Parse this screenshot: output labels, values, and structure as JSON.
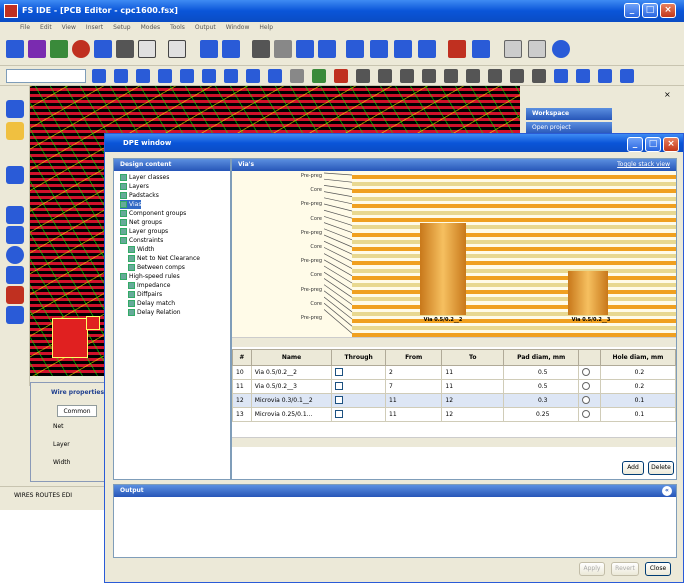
{
  "app": {
    "title": "FS IDE - [PCB Editor - cpc1600.fsx]",
    "menu": [
      "File",
      "Edit",
      "View",
      "Insert",
      "Setup",
      "Modes",
      "Tools",
      "Output",
      "Window",
      "Help"
    ],
    "status_text": "WIRES ROUTES EDI"
  },
  "workspace": {
    "title": "Workspace",
    "item": "Open project"
  },
  "wire_panel": {
    "title": "Wire properties",
    "tab": "Common",
    "rows": [
      "Net",
      "Layer",
      "Width"
    ]
  },
  "dpe": {
    "title": "DPE window",
    "design_content_header": "Design content",
    "tree": [
      {
        "label": "Layer classes",
        "indent": 0,
        "selected": false
      },
      {
        "label": "Layers",
        "indent": 0,
        "selected": false
      },
      {
        "label": "Padstacks",
        "indent": 0,
        "selected": false
      },
      {
        "label": "Vias",
        "indent": 0,
        "selected": true
      },
      {
        "label": "Component groups",
        "indent": 0,
        "selected": false
      },
      {
        "label": "Net groups",
        "indent": 0,
        "selected": false
      },
      {
        "label": "Layer groups",
        "indent": 0,
        "selected": false
      },
      {
        "label": "Constraints",
        "indent": 0,
        "selected": false
      },
      {
        "label": "Width",
        "indent": 1,
        "selected": false
      },
      {
        "label": "Net to Net Clearance",
        "indent": 1,
        "selected": false
      },
      {
        "label": "Between comps",
        "indent": 1,
        "selected": false
      },
      {
        "label": "High-speed rules",
        "indent": 0,
        "selected": false
      },
      {
        "label": "Impedance",
        "indent": 1,
        "selected": false
      },
      {
        "label": "Diffpairs",
        "indent": 1,
        "selected": false
      },
      {
        "label": "Delay match",
        "indent": 1,
        "selected": false
      },
      {
        "label": "Delay Relation",
        "indent": 1,
        "selected": false
      }
    ],
    "vias_header": "Via's",
    "toggle_link": "Toggle stack view",
    "stack_labels": [
      "Pre-preg",
      "Core",
      "Pre-preg",
      "Core",
      "Pre-preg",
      "Core",
      "Pre-preg",
      "Core",
      "Pre-preg",
      "Core",
      "Pre-preg"
    ],
    "via_labels": [
      "Via 0.5/0.2__2",
      "Via 0.5/0.2__3"
    ],
    "table": {
      "headers": [
        "#",
        "Name",
        "Through",
        "From",
        "To",
        "Pad diam, mm",
        "",
        "Hole diam, mm"
      ],
      "rows": [
        {
          "n": "10",
          "name": "Via 0.5/0.2__2",
          "from": "2",
          "to": "11",
          "pad": "0.5",
          "hole": "0.2",
          "sel": false
        },
        {
          "n": "11",
          "name": "Via 0.5/0.2__3",
          "from": "7",
          "to": "11",
          "pad": "0.5",
          "hole": "0.2",
          "sel": false
        },
        {
          "n": "12",
          "name": "Microvia 0.3/0.1__2",
          "from": "11",
          "to": "12",
          "pad": "0.3",
          "hole": "0.1",
          "sel": true
        },
        {
          "n": "13",
          "name": "Microvia 0.25/0.1...",
          "from": "11",
          "to": "12",
          "pad": "0.25",
          "hole": "0.1",
          "sel": false
        }
      ]
    },
    "add_button": "Add",
    "delete_button": "Delete",
    "output_header": "Output",
    "apply_button": "Apply",
    "revert_button": "Revert",
    "close_button": "Close"
  },
  "colors": {
    "titlebar": "#0a55d8",
    "pcb_red": "#d0102a",
    "pcb_green": "#00ff00",
    "via_gold": "#e8a030"
  }
}
